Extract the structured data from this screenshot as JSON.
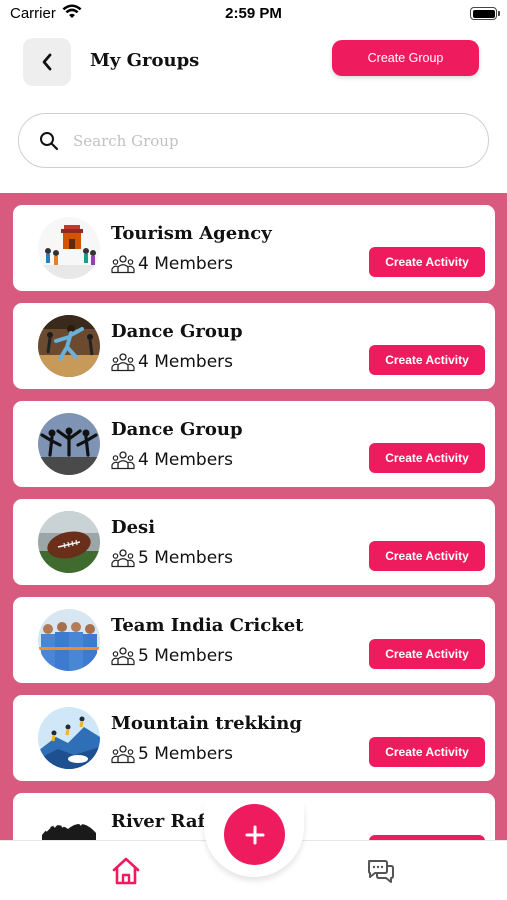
{
  "status_bar": {
    "carrier": "Carrier",
    "time": "2:59 PM"
  },
  "header": {
    "title": "My Groups",
    "create_group_label": "Create Group"
  },
  "search": {
    "placeholder": "Search Group",
    "value": ""
  },
  "colors": {
    "accent": "#ee1c5f",
    "list_background": "#d95a7f"
  },
  "groups": [
    {
      "name": "Tourism Agency",
      "members": "4 Members",
      "action_label": "Create Activity",
      "avatar": "tourism-illustration"
    },
    {
      "name": "Dance Group",
      "members": "4 Members",
      "action_label": "Create Activity",
      "avatar": "dancer-photo"
    },
    {
      "name": "Dance Group",
      "members": "4 Members",
      "action_label": "Create Activity",
      "avatar": "dance-troupe-photo"
    },
    {
      "name": "Desi",
      "members": "5 Members",
      "action_label": "Create Activity",
      "avatar": "football-photo"
    },
    {
      "name": "Team India Cricket",
      "members": "5 Members",
      "action_label": "Create Activity",
      "avatar": "cricket-team-photo"
    },
    {
      "name": "Mountain trekking",
      "members": "5 Members",
      "action_label": "Create Activity",
      "avatar": "trekking-illustration"
    },
    {
      "name": "River Rafting",
      "members": "",
      "action_label": "",
      "avatar": "rafting-illustration"
    }
  ],
  "bottom_nav": {
    "items": [
      {
        "icon": "home-icon",
        "active": true
      },
      {
        "icon": "chat-icon",
        "active": false
      }
    ],
    "fab_icon": "plus-icon"
  }
}
